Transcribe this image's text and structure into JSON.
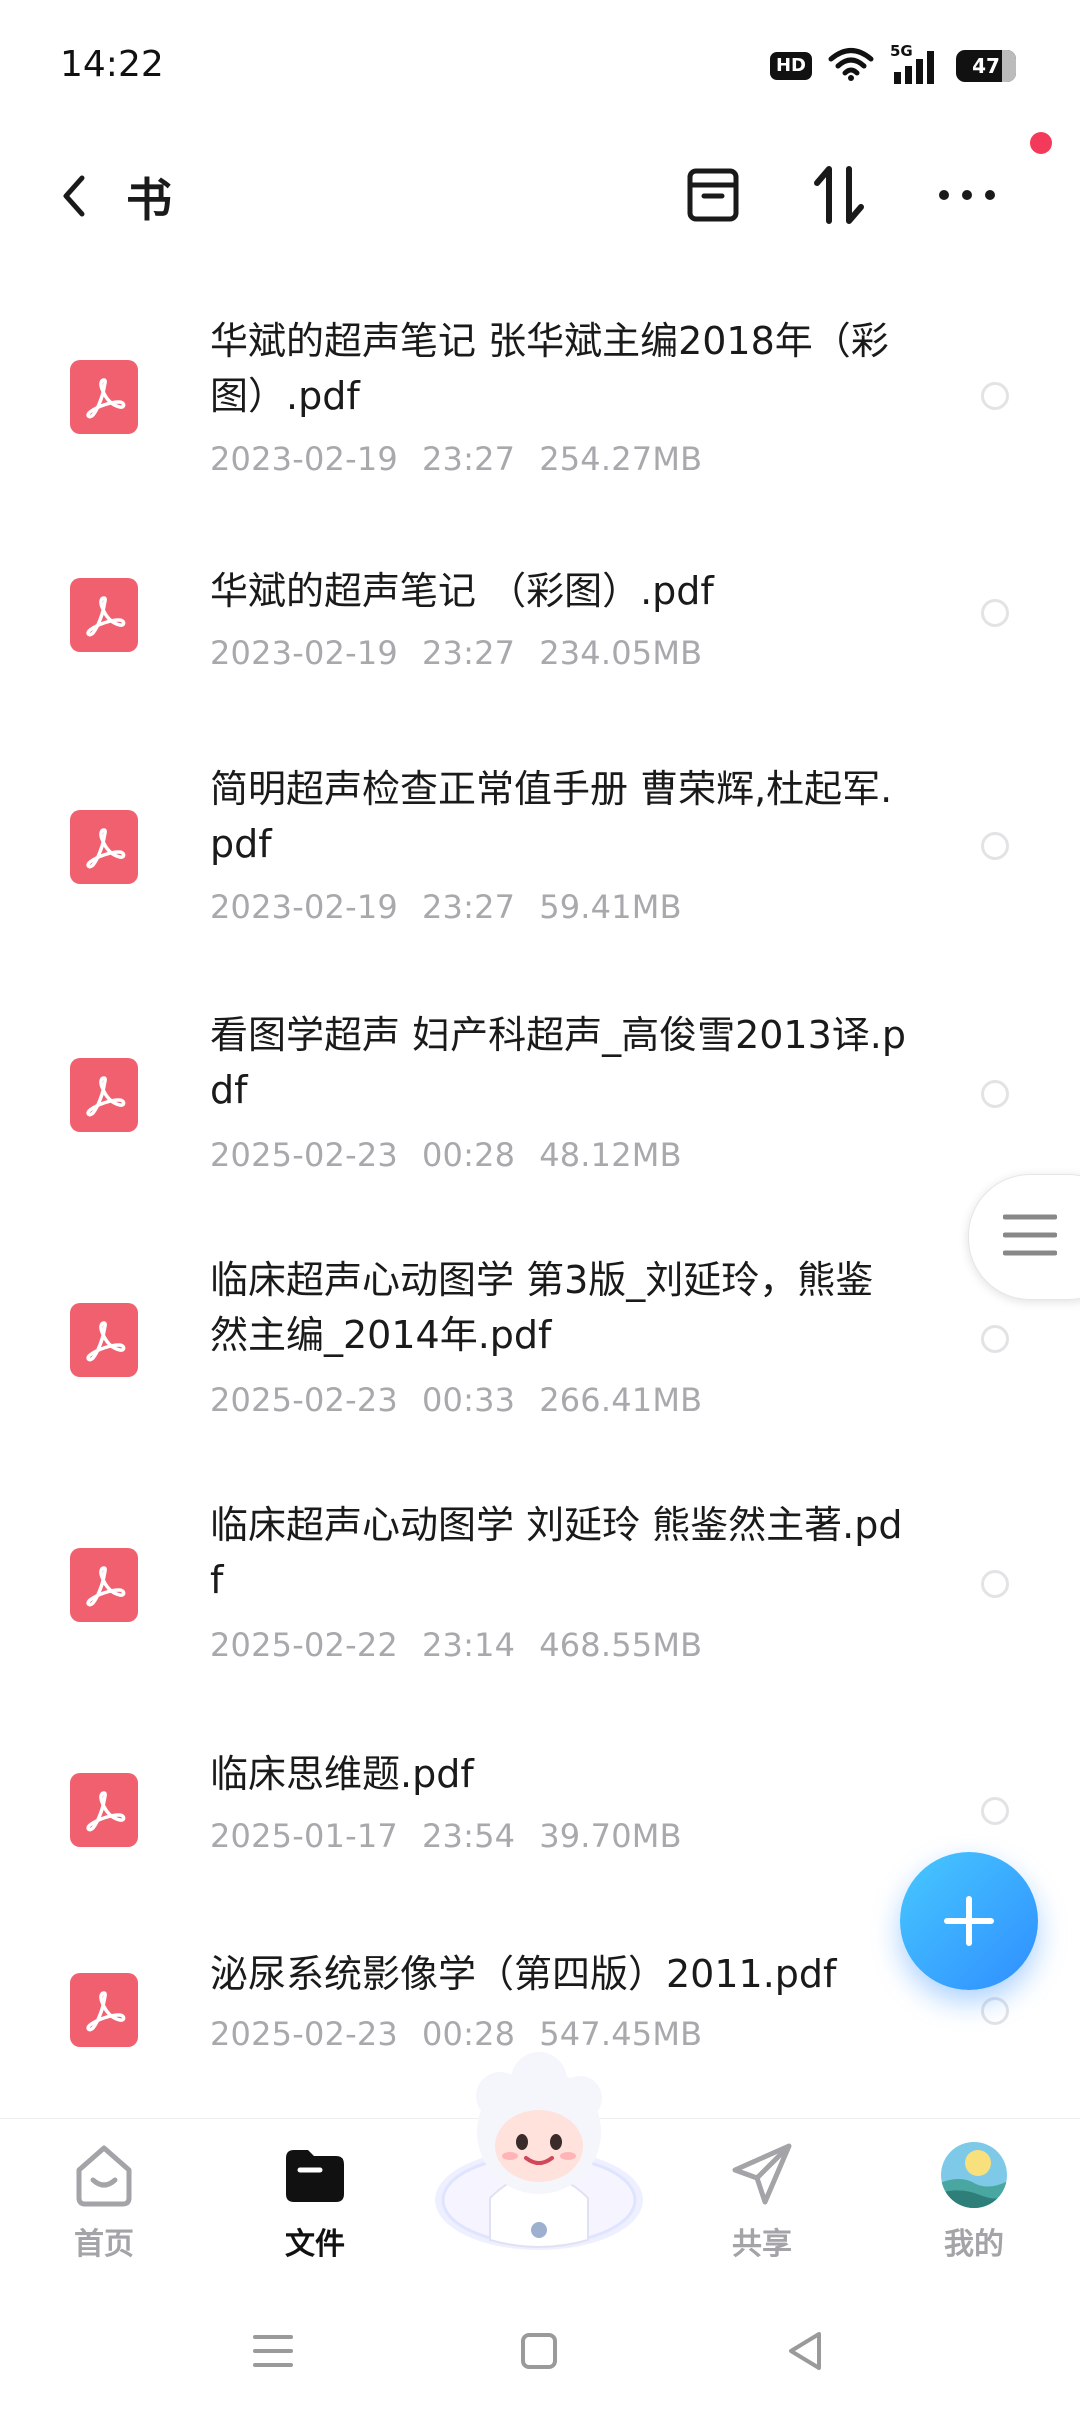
{
  "status_bar": {
    "time": "14:22",
    "hd": "HD",
    "network": "5G",
    "battery": "47"
  },
  "header": {
    "title": "书",
    "icons": [
      "back-chevron-icon",
      "archive-box-icon",
      "sort-icon",
      "more-icon"
    ]
  },
  "files": [
    {
      "name": "华斌的超声笔记 张华斌主编2018年（彩图）.pdf",
      "date": "2023-02-19",
      "time": "23:27",
      "size": "254.27MB"
    },
    {
      "name": "华斌的超声笔记 （彩图）.pdf",
      "date": "2023-02-19",
      "time": "23:27",
      "size": "234.05MB"
    },
    {
      "name": "简明超声检查正常值手册 曹荣辉,杜起军.pdf",
      "date": "2023-02-19",
      "time": "23:27",
      "size": "59.41MB"
    },
    {
      "name": "看图学超声 妇产科超声_高俊雪2013译.pdf",
      "date": "2025-02-23",
      "time": "00:28",
      "size": "48.12MB"
    },
    {
      "name": "临床超声心动图学 第3版_刘延玲，熊鉴然主编_2014年.pdf",
      "date": "2025-02-23",
      "time": "00:33",
      "size": "266.41MB"
    },
    {
      "name": "临床超声心动图学 刘延玲 熊鉴然主著.pdf",
      "date": "2025-02-22",
      "time": "23:14",
      "size": "468.55MB"
    },
    {
      "name": "临床思维题.pdf",
      "date": "2025-01-17",
      "time": "23:54",
      "size": "39.70MB"
    },
    {
      "name": "泌尿系统影像学（第四版）2011.pdf",
      "date": "2025-02-23",
      "time": "00:28",
      "size": "547.45MB"
    }
  ],
  "bottom_nav": {
    "items": [
      {
        "label": "首页",
        "icon": "home-smile-icon",
        "active": false
      },
      {
        "label": "文件",
        "icon": "folder-icon",
        "active": true
      },
      {
        "label": "共享",
        "icon": "share-paper-plane-icon",
        "active": false
      },
      {
        "label": "我的",
        "icon": "avatar-icon",
        "active": false
      }
    ]
  },
  "colors": {
    "accent": "#2f8eff",
    "pdf": "#f0606f",
    "meta": "#a8a8ad",
    "notify": "#f43a5a"
  }
}
